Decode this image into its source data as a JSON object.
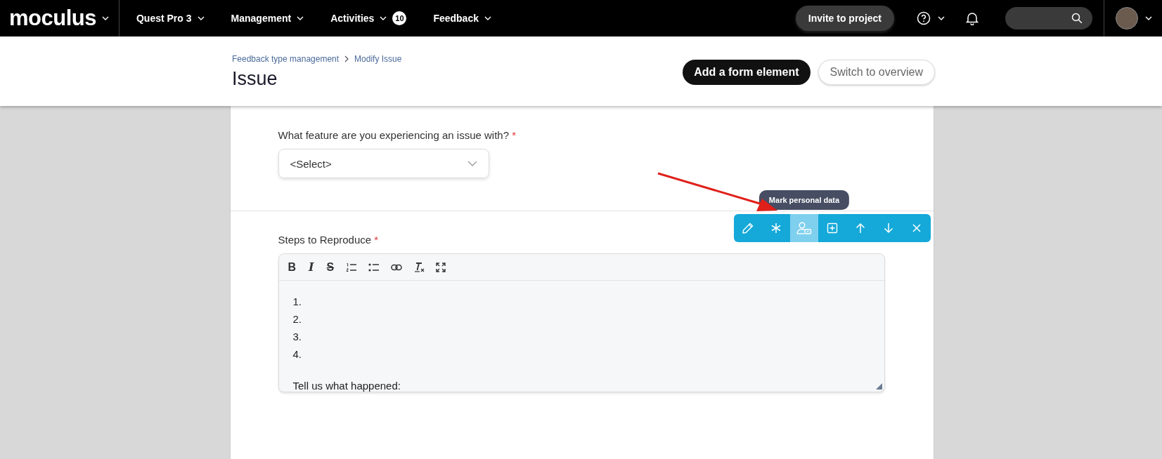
{
  "top_bar": {
    "logo": "moculus",
    "nav": [
      {
        "label": "Quest Pro 3"
      },
      {
        "label": "Management"
      },
      {
        "label": "Activities",
        "badge": "10"
      },
      {
        "label": "Feedback"
      }
    ],
    "invite_button": "Invite to project"
  },
  "header": {
    "breadcrumb": [
      "Feedback type management",
      "Modify Issue"
    ],
    "title": "Issue",
    "buttons": [
      {
        "label": "Add a form element",
        "kind": "primary"
      },
      {
        "label": "Switch to overview",
        "kind": "secondary"
      }
    ]
  },
  "form_elements": [
    {
      "kind": "select",
      "label": "What feature are you experiencing an issue with?",
      "required_mark": "*",
      "value": "<Select>"
    },
    {
      "kind": "rich_text",
      "label": "Steps to Reproduce",
      "required_mark": "*",
      "editor_tools": [
        {
          "kind": "bold",
          "glyph": "B"
        },
        {
          "kind": "italic",
          "glyph": "I"
        },
        {
          "kind": "strike",
          "glyph": "S"
        },
        {
          "kind": "ordered-list"
        },
        {
          "kind": "bullet-list"
        },
        {
          "kind": "link"
        },
        {
          "kind": "clear-format"
        },
        {
          "kind": "fullscreen"
        }
      ],
      "list_items": [
        "1.",
        "2.",
        "3.",
        "4."
      ],
      "paragraph": "Tell us what happened:"
    }
  ],
  "element_toolbar": {
    "tooltip": "Mark personal data",
    "buttons": [
      {
        "kind": "edit",
        "selected": false
      },
      {
        "kind": "required",
        "selected": false
      },
      {
        "kind": "personal-data",
        "selected": true
      },
      {
        "kind": "add",
        "selected": false
      },
      {
        "kind": "move-up",
        "selected": false
      },
      {
        "kind": "move-down",
        "selected": false
      },
      {
        "kind": "remove",
        "selected": false
      }
    ]
  }
}
